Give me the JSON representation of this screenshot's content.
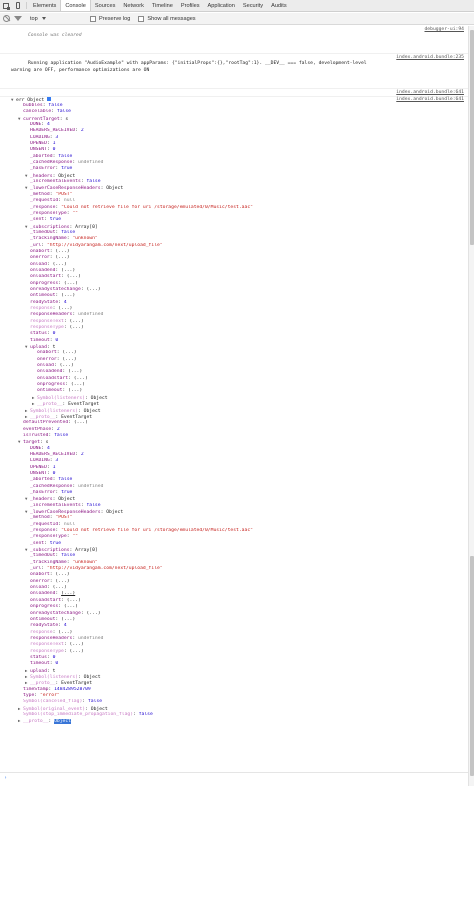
{
  "toolbar": {
    "tabs": [
      "Elements",
      "Console",
      "Sources",
      "Network",
      "Timeline",
      "Profiles",
      "Application",
      "Security",
      "Audits"
    ],
    "active_tab": "Console"
  },
  "filter": {
    "context": "top",
    "preserve_log": "Preserve log",
    "show_all": "Show all messages"
  },
  "messages": [
    {
      "text": "Console was cleared",
      "source": "debugger-ui:94",
      "italic": true
    },
    {
      "text": "Running application \"AudioExample\" with appParams: {\"initialProps\":{},\"rootTag\":1}. __DEV__ === false, development-level\nwarning are OFF, performance optimizations are ON",
      "source": "index.android.bundle:235",
      "italic": false
    },
    {
      "text": "",
      "source": "index.android.bundle:641",
      "italic": false
    },
    {
      "text": "",
      "source": "index.android.bundle:641",
      "italic": false
    }
  ],
  "tree": [
    {
      "d": 0,
      "t": "open",
      "k": "err ",
      "v": "Object",
      "c": "obj",
      "kc": "plain",
      "info": true
    },
    {
      "d": 1,
      "t": "",
      "k": "bubbles",
      "v": "false",
      "c": "num"
    },
    {
      "d": 1,
      "t": "",
      "k": "cancelable",
      "v": "false",
      "c": "num"
    },
    {
      "d": 1,
      "t": "open",
      "k": "currentTarget",
      "v": "s",
      "c": "obj"
    },
    {
      "d": 2,
      "t": "",
      "k": "DONE",
      "v": "4",
      "c": "num"
    },
    {
      "d": 2,
      "t": "",
      "k": "HEADERS_RECEIVED",
      "v": "2",
      "c": "num"
    },
    {
      "d": 2,
      "t": "",
      "k": "LOADING",
      "v": "3",
      "c": "num"
    },
    {
      "d": 2,
      "t": "",
      "k": "OPENED",
      "v": "1",
      "c": "num"
    },
    {
      "d": 2,
      "t": "",
      "k": "UNSENT",
      "v": "0",
      "c": "num"
    },
    {
      "d": 2,
      "t": "",
      "k": "_aborted",
      "v": "false",
      "c": "num"
    },
    {
      "d": 2,
      "t": "",
      "k": "_cachedResponse",
      "v": "undefined",
      "c": "gray"
    },
    {
      "d": 2,
      "t": "",
      "k": "_hasError",
      "v": "true",
      "c": "num"
    },
    {
      "d": 2,
      "t": "open",
      "k": "_headers",
      "v": "Object",
      "c": "obj"
    },
    {
      "d": 2,
      "t": "",
      "k": "_incrementalEvents",
      "v": "false",
      "c": "num"
    },
    {
      "d": 2,
      "t": "open",
      "k": "_lowerCaseResponseHeaders",
      "v": "Object",
      "c": "obj"
    },
    {
      "d": 2,
      "t": "",
      "k": "_method",
      "v": "\"POST\"",
      "c": "str"
    },
    {
      "d": 2,
      "t": "",
      "k": "_requestId",
      "v": "null",
      "c": "gray"
    },
    {
      "d": 2,
      "t": "",
      "k": "_response",
      "v": "\"Could not retrieve file for uri /storage/emulated/0/Music/test.aac\"",
      "c": "str"
    },
    {
      "d": 2,
      "t": "",
      "k": "_responseType",
      "v": "\"\"",
      "c": "str"
    },
    {
      "d": 2,
      "t": "",
      "k": "_sent",
      "v": "true",
      "c": "num"
    },
    {
      "d": 2,
      "t": "open",
      "k": "_subscriptions",
      "v": "Array[0]",
      "c": "obj"
    },
    {
      "d": 2,
      "t": "",
      "k": "_timedOut",
      "v": "false",
      "c": "num"
    },
    {
      "d": 2,
      "t": "",
      "k": "_trackingName",
      "v": "\"unknown\"",
      "c": "str"
    },
    {
      "d": 2,
      "t": "",
      "k": "_url",
      "v": "\"http://vidyarangam.com/next/upload_file\"",
      "c": "str"
    },
    {
      "d": 2,
      "t": "",
      "k": "onabort",
      "v": "(...)",
      "c": "obj"
    },
    {
      "d": 2,
      "t": "",
      "k": "onerror",
      "v": "(...)",
      "c": "obj"
    },
    {
      "d": 2,
      "t": "",
      "k": "onload",
      "v": "(...)",
      "c": "obj"
    },
    {
      "d": 2,
      "t": "",
      "k": "onloadend",
      "v": "(...)",
      "c": "obj"
    },
    {
      "d": 2,
      "t": "",
      "k": "onloadstart",
      "v": "(...)",
      "c": "obj"
    },
    {
      "d": 2,
      "t": "",
      "k": "onprogress",
      "v": "(...)",
      "c": "obj"
    },
    {
      "d": 2,
      "t": "",
      "k": "onreadystatechange",
      "v": "(...)",
      "c": "obj"
    },
    {
      "d": 2,
      "t": "",
      "k": "ontimeout",
      "v": "(...)",
      "c": "obj"
    },
    {
      "d": 2,
      "t": "",
      "k": "readyState",
      "v": "4",
      "c": "num"
    },
    {
      "d": 2,
      "t": "",
      "k": "response",
      "v": "(...)",
      "c": "obj",
      "kc": "dim"
    },
    {
      "d": 2,
      "t": "",
      "k": "responseHeaders",
      "v": "undefined",
      "c": "gray"
    },
    {
      "d": 2,
      "t": "",
      "k": "responseText",
      "v": "(...)",
      "c": "obj",
      "kc": "dim"
    },
    {
      "d": 2,
      "t": "",
      "k": "responseType",
      "v": "(...)",
      "c": "obj",
      "kc": "dim"
    },
    {
      "d": 2,
      "t": "",
      "k": "status",
      "v": "0",
      "c": "num"
    },
    {
      "d": 2,
      "t": "",
      "k": "timeout",
      "v": "0",
      "c": "num"
    },
    {
      "d": 2,
      "t": "open",
      "k": "upload",
      "v": "t",
      "c": "obj"
    },
    {
      "d": 3,
      "t": "",
      "k": "onabort",
      "v": "(...)",
      "c": "obj"
    },
    {
      "d": 3,
      "t": "",
      "k": "onerror",
      "v": "(...)",
      "c": "obj"
    },
    {
      "d": 3,
      "t": "",
      "k": "onload",
      "v": "(...)",
      "c": "obj"
    },
    {
      "d": 3,
      "t": "",
      "k": "onloadend",
      "v": "(...)",
      "c": "obj"
    },
    {
      "d": 3,
      "t": "",
      "k": "onloadstart",
      "v": "(...)",
      "c": "obj"
    },
    {
      "d": 3,
      "t": "",
      "k": "onprogress",
      "v": "(...)",
      "c": "obj"
    },
    {
      "d": 3,
      "t": "",
      "k": "ontimeout",
      "v": "(...)",
      "c": "obj"
    },
    {
      "d": 3,
      "t": "closed",
      "k": "Symbol(listeners)",
      "v": "Object",
      "c": "obj",
      "kc": "dim"
    },
    {
      "d": 3,
      "t": "closed",
      "k": "__proto__",
      "v": "EventTarget",
      "c": "obj",
      "kc": "dim"
    },
    {
      "d": 2,
      "t": "closed",
      "k": "Symbol(listeners)",
      "v": "Object",
      "c": "obj",
      "kc": "dim"
    },
    {
      "d": 2,
      "t": "closed",
      "k": "__proto__",
      "v": "EventTarget",
      "c": "obj",
      "kc": "dim"
    },
    {
      "d": 1,
      "t": "",
      "k": "defaultPrevented",
      "v": "(...)",
      "c": "obj"
    },
    {
      "d": 1,
      "t": "",
      "k": "eventPhase",
      "v": "2",
      "c": "num"
    },
    {
      "d": 1,
      "t": "",
      "k": "isTrusted",
      "v": "false",
      "c": "num"
    },
    {
      "d": 1,
      "t": "open",
      "k": "target",
      "v": "s",
      "c": "obj"
    },
    {
      "d": 2,
      "t": "",
      "k": "DONE",
      "v": "4",
      "c": "num"
    },
    {
      "d": 2,
      "t": "",
      "k": "HEADERS_RECEIVED",
      "v": "2",
      "c": "num"
    },
    {
      "d": 2,
      "t": "",
      "k": "LOADING",
      "v": "3",
      "c": "num"
    },
    {
      "d": 2,
      "t": "",
      "k": "OPENED",
      "v": "1",
      "c": "num"
    },
    {
      "d": 2,
      "t": "",
      "k": "UNSENT",
      "v": "0",
      "c": "num"
    },
    {
      "d": 2,
      "t": "",
      "k": "_aborted",
      "v": "false",
      "c": "num"
    },
    {
      "d": 2,
      "t": "",
      "k": "_cachedResponse",
      "v": "undefined",
      "c": "gray"
    },
    {
      "d": 2,
      "t": "",
      "k": "_hasError",
      "v": "true",
      "c": "num"
    },
    {
      "d": 2,
      "t": "open",
      "k": "_headers",
      "v": "Object",
      "c": "obj"
    },
    {
      "d": 2,
      "t": "",
      "k": "_incrementalEvents",
      "v": "false",
      "c": "num"
    },
    {
      "d": 2,
      "t": "open",
      "k": "_lowerCaseResponseHeaders",
      "v": "Object",
      "c": "obj"
    },
    {
      "d": 2,
      "t": "",
      "k": "_method",
      "v": "\"POST\"",
      "c": "str"
    },
    {
      "d": 2,
      "t": "",
      "k": "_requestId",
      "v": "null",
      "c": "gray"
    },
    {
      "d": 2,
      "t": "",
      "k": "_response",
      "v": "\"Could not retrieve file for uri /storage/emulated/0/Music/test.aac\"",
      "c": "str"
    },
    {
      "d": 2,
      "t": "",
      "k": "_responseType",
      "v": "\"\"",
      "c": "str"
    },
    {
      "d": 2,
      "t": "",
      "k": "_sent",
      "v": "true",
      "c": "num"
    },
    {
      "d": 2,
      "t": "open",
      "k": "_subscriptions",
      "v": "Array[0]",
      "c": "obj"
    },
    {
      "d": 2,
      "t": "",
      "k": "_timedOut",
      "v": "false",
      "c": "num"
    },
    {
      "d": 2,
      "t": "",
      "k": "_trackingName",
      "v": "\"unknown\"",
      "c": "str"
    },
    {
      "d": 2,
      "t": "",
      "k": "_url",
      "v": "\"http://vidyarangam.com/next/upload_file\"",
      "c": "str"
    },
    {
      "d": 2,
      "t": "",
      "k": "onabort",
      "v": "(...)",
      "c": "obj"
    },
    {
      "d": 2,
      "t": "",
      "k": "onerror",
      "v": "(...)",
      "c": "obj"
    },
    {
      "d": 2,
      "t": "",
      "k": "onload",
      "v": "(...)",
      "c": "obj"
    },
    {
      "d": 2,
      "t": "",
      "k": "onloadend",
      "v": "(...)",
      "c": "obj",
      "link": true
    },
    {
      "d": 2,
      "t": "",
      "k": "onloadstart",
      "v": "(...)",
      "c": "obj"
    },
    {
      "d": 2,
      "t": "",
      "k": "onprogress",
      "v": "(...)",
      "c": "obj"
    },
    {
      "d": 2,
      "t": "",
      "k": "onreadystatechange",
      "v": "(...)",
      "c": "obj"
    },
    {
      "d": 2,
      "t": "",
      "k": "ontimeout",
      "v": "(...)",
      "c": "obj"
    },
    {
      "d": 2,
      "t": "",
      "k": "readyState",
      "v": "4",
      "c": "num"
    },
    {
      "d": 2,
      "t": "",
      "k": "response",
      "v": "(...)",
      "c": "obj",
      "kc": "dim"
    },
    {
      "d": 2,
      "t": "",
      "k": "responseHeaders",
      "v": "undefined",
      "c": "gray"
    },
    {
      "d": 2,
      "t": "",
      "k": "responseText",
      "v": "(...)",
      "c": "obj",
      "kc": "dim"
    },
    {
      "d": 2,
      "t": "",
      "k": "responseType",
      "v": "(...)",
      "c": "obj",
      "kc": "dim"
    },
    {
      "d": 2,
      "t": "",
      "k": "status",
      "v": "0",
      "c": "num"
    },
    {
      "d": 2,
      "t": "",
      "k": "timeout",
      "v": "0",
      "c": "num"
    },
    {
      "d": 2,
      "t": "closed",
      "k": "upload",
      "v": "t",
      "c": "obj"
    },
    {
      "d": 2,
      "t": "closed",
      "k": "Symbol(listeners)",
      "v": "Object",
      "c": "obj",
      "kc": "dim"
    },
    {
      "d": 2,
      "t": "closed",
      "k": "__proto__",
      "v": "EventTarget",
      "c": "obj",
      "kc": "dim"
    },
    {
      "d": 1,
      "t": "",
      "k": "timeStamp",
      "v": "1484289528709",
      "c": "num"
    },
    {
      "d": 1,
      "t": "",
      "k": "type",
      "v": "\"error\"",
      "c": "str"
    },
    {
      "d": 1,
      "t": "",
      "k": "Symbol(canceled_flag)",
      "v": "false",
      "c": "num",
      "kc": "dim"
    },
    {
      "d": 1,
      "t": "closed",
      "k": "Symbol(original_event)",
      "v": "Object",
      "c": "obj",
      "kc": "dim"
    },
    {
      "d": 1,
      "t": "",
      "k": "Symbol(stop_immediate_propagation_flag)",
      "v": "false",
      "c": "num",
      "kc": "dim"
    },
    {
      "d": 1,
      "t": "closed",
      "k": "__proto__",
      "v": "Object",
      "c": "sel",
      "kc": "dim"
    }
  ],
  "prompt_symbol": "›",
  "colors": {
    "key": "#881280",
    "number": "#1c00cf",
    "string": "#c41a16",
    "accent": "#367cf1"
  }
}
